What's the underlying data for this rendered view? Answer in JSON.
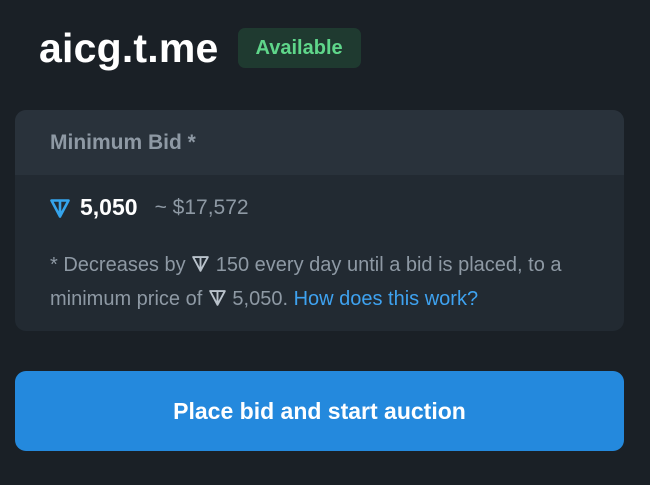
{
  "header": {
    "domain": "aicg.t.me",
    "status": "Available"
  },
  "bid": {
    "title": "Minimum Bid *",
    "amount": "5,050",
    "usd_estimate": "~ $17,572",
    "note_part1": "* Decreases by",
    "note_part2": "150 every day until a bid is placed, to a minimum price of",
    "note_part3": "5,050.",
    "help_link": "How does this work?"
  },
  "actions": {
    "primary_label": "Place bid and start auction"
  },
  "colors": {
    "background": "#1a2026",
    "badge_bg": "#1f3a30",
    "badge_text": "#5fd68a",
    "accent": "#2489dd",
    "link": "#3ea2f0",
    "ton": "#35a4ec"
  },
  "icons": {
    "currency": "ton-icon"
  }
}
